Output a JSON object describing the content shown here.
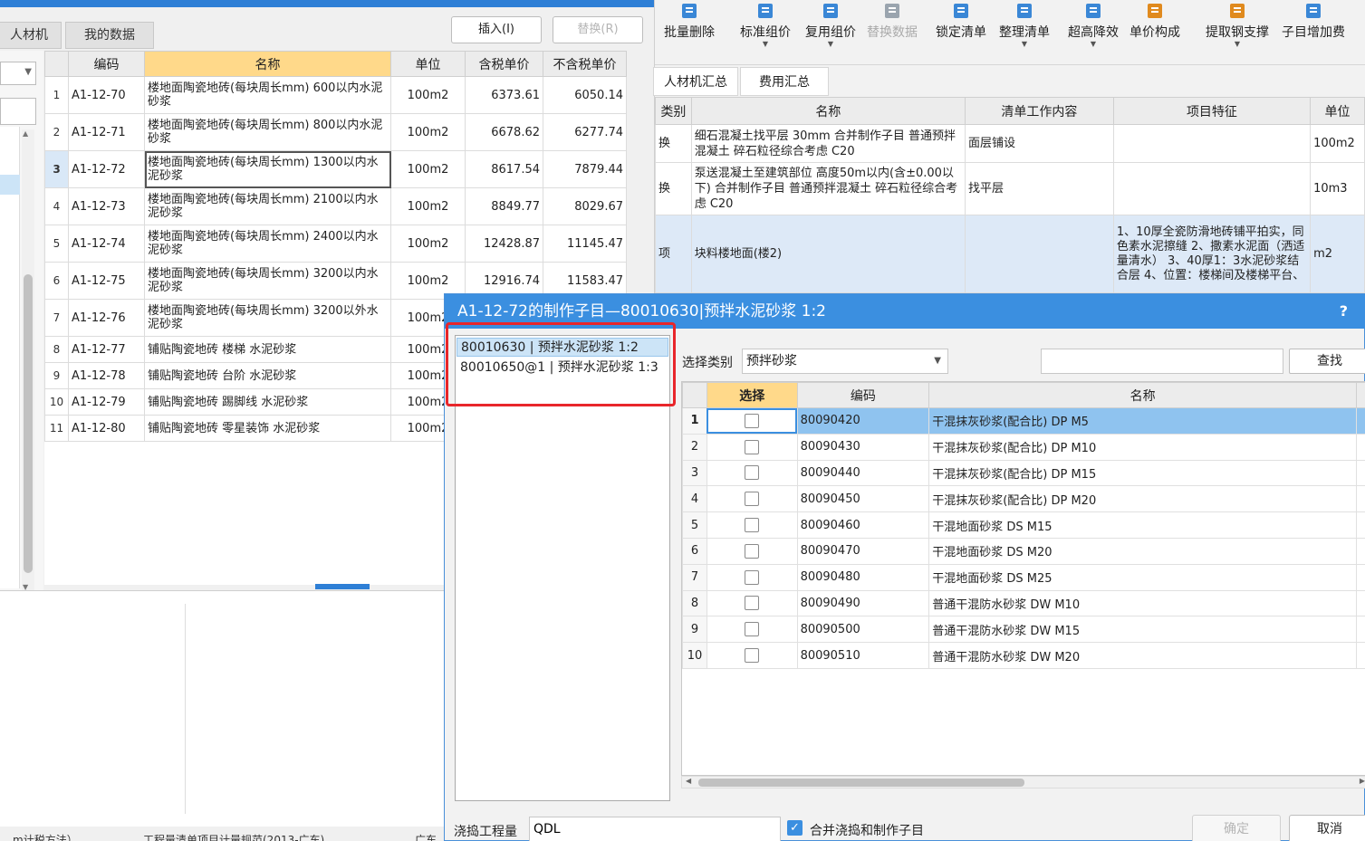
{
  "left": {
    "tabs": [
      "人材机",
      "我的数据"
    ],
    "insert_label": "插入(I)",
    "replace_label": "替换(R)",
    "headers": [
      "编码",
      "名称",
      "单位",
      "含税单价",
      "不含税单价"
    ],
    "rows": [
      {
        "n": "1",
        "code": "A1-12-70",
        "name": "楼地面陶瓷地砖(每块周长mm) 600以内水泥砂浆",
        "unit": "100m2",
        "tax": "6373.61",
        "notax": "6050.14"
      },
      {
        "n": "2",
        "code": "A1-12-71",
        "name": "楼地面陶瓷地砖(每块周长mm) 800以内水泥砂浆",
        "unit": "100m2",
        "tax": "6678.62",
        "notax": "6277.74"
      },
      {
        "n": "3",
        "code": "A1-12-72",
        "name": "楼地面陶瓷地砖(每块周长mm) 1300以内水泥砂浆",
        "unit": "100m2",
        "tax": "8617.54",
        "notax": "7879.44"
      },
      {
        "n": "4",
        "code": "A1-12-73",
        "name": "楼地面陶瓷地砖(每块周长mm) 2100以内水泥砂浆",
        "unit": "100m2",
        "tax": "8849.77",
        "notax": "8029.67"
      },
      {
        "n": "5",
        "code": "A1-12-74",
        "name": "楼地面陶瓷地砖(每块周长mm) 2400以内水泥砂浆",
        "unit": "100m2",
        "tax": "12428.87",
        "notax": "11145.47"
      },
      {
        "n": "6",
        "code": "A1-12-75",
        "name": "楼地面陶瓷地砖(每块周长mm) 3200以内水泥砂浆",
        "unit": "100m2",
        "tax": "12916.74",
        "notax": "11583.47"
      },
      {
        "n": "7",
        "code": "A1-12-76",
        "name": "楼地面陶瓷地砖(每块周长mm) 3200以外水泥砂浆",
        "unit": "100m2",
        "tax": "",
        "notax": ""
      },
      {
        "n": "8",
        "code": "A1-12-77",
        "name": "铺贴陶瓷地砖 楼梯 水泥砂浆",
        "unit": "100m2",
        "tax": "",
        "notax": ""
      },
      {
        "n": "9",
        "code": "A1-12-78",
        "name": "铺贴陶瓷地砖 台阶 水泥砂浆",
        "unit": "100m2",
        "tax": "",
        "notax": ""
      },
      {
        "n": "10",
        "code": "A1-12-79",
        "name": "铺贴陶瓷地砖 踢脚线 水泥砂浆",
        "unit": "100m2",
        "tax": "",
        "notax": ""
      },
      {
        "n": "11",
        "code": "A1-12-80",
        "name": "铺贴陶瓷地砖 零星装饰 水泥砂浆",
        "unit": "100m2",
        "tax": "",
        "notax": ""
      }
    ],
    "status": [
      "m计税方法）",
      "工程量清单项目计量规范(2013-广东)",
      "广东"
    ]
  },
  "ribbon": [
    {
      "label": "批量删除",
      "icon": "batch-delete-icon",
      "arrow": false,
      "disabled": false
    },
    {
      "label": "标准组价",
      "icon": "standard-pricing-icon",
      "arrow": true,
      "disabled": false
    },
    {
      "label": "复用组价",
      "icon": "reuse-pricing-icon",
      "arrow": true,
      "disabled": false
    },
    {
      "label": "替换数据",
      "icon": "replace-data-icon",
      "arrow": false,
      "disabled": true
    },
    {
      "label": "锁定清单",
      "icon": "lock-icon",
      "arrow": false,
      "disabled": false
    },
    {
      "label": "整理清单",
      "icon": "organize-list-icon",
      "arrow": true,
      "disabled": false
    },
    {
      "label": "超高降效",
      "icon": "high-rise-icon",
      "arrow": true,
      "disabled": false
    },
    {
      "label": "单价构成",
      "icon": "unit-price-icon",
      "arrow": false,
      "disabled": false
    },
    {
      "label": "提取钢支撑",
      "icon": "steel-support-icon",
      "arrow": true,
      "disabled": false
    },
    {
      "label": "子目增加费",
      "icon": "sub-item-fee-icon",
      "arrow": false,
      "disabled": false
    }
  ],
  "right_tabs": [
    "人材机汇总",
    "费用汇总"
  ],
  "bill": {
    "headers": [
      "类别",
      "名称",
      "清单工作内容",
      "项目特征",
      "单位"
    ],
    "rows": [
      {
        "type": "换",
        "name": "细石混凝土找平层 30mm 合并制作子目 普通预拌混凝土 碎石粒径综合考虑 C20",
        "work": "面层铺设",
        "feature": "",
        "unit": "100m2"
      },
      {
        "type": "换",
        "name": "泵送混凝土至建筑部位 高度50m以内(含±0.00以下) 合并制作子目 普通预拌混凝土 碎石粒径综合考虑 C20",
        "work": "找平层",
        "feature": "",
        "unit": "10m3"
      },
      {
        "type": "项",
        "name": "块料楼地面(楼2)",
        "work": "",
        "feature": "1、10厚全瓷防滑地砖铺平拍实，同色素水泥擦缝 2、撒素水泥面（洒适量清水） 3、40厚1：3水泥砂浆结合层 4、位置：楼梯间及楼梯平台、",
        "unit": "m2"
      }
    ]
  },
  "dialog": {
    "title": "A1-12-72的制作子目—80010630|预拌水泥砂浆 1:2",
    "help": "?",
    "child_items": [
      "80010630 | 预拌水泥砂浆 1:2",
      "80010650@1 | 预拌水泥砂浆 1:3"
    ],
    "category_label": "选择类别",
    "category_value": "预拌砂浆",
    "search_value": "",
    "find_label": "查找",
    "headers": [
      "选择",
      "编码",
      "名称"
    ],
    "materials": [
      {
        "n": "1",
        "code": "80090420",
        "name": "干混抹灰砂浆(配合比) DP M5"
      },
      {
        "n": "2",
        "code": "80090430",
        "name": "干混抹灰砂浆(配合比) DP M10"
      },
      {
        "n": "3",
        "code": "80090440",
        "name": "干混抹灰砂浆(配合比) DP M15"
      },
      {
        "n": "4",
        "code": "80090450",
        "name": "干混抹灰砂浆(配合比) DP M20"
      },
      {
        "n": "5",
        "code": "80090460",
        "name": "干混地面砂浆 DS M15"
      },
      {
        "n": "6",
        "code": "80090470",
        "name": "干混地面砂浆 DS M20"
      },
      {
        "n": "7",
        "code": "80090480",
        "name": "干混地面砂浆 DS M25"
      },
      {
        "n": "8",
        "code": "80090490",
        "name": "普通干混防水砂浆 DW M10"
      },
      {
        "n": "9",
        "code": "80090500",
        "name": "普通干混防水砂浆 DW M15"
      },
      {
        "n": "10",
        "code": "80090510",
        "name": "普通干混防水砂浆 DW M20"
      }
    ],
    "qty_label": "浇捣工程量",
    "qty_value": "QDL",
    "merge_label": "合并浇捣和制作子目",
    "ok_label": "确定",
    "cancel_label": "取消"
  }
}
